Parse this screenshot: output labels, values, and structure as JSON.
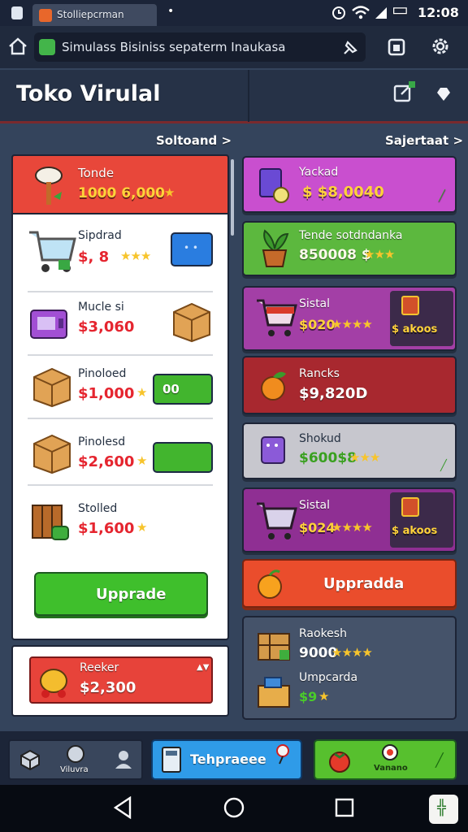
{
  "status_bar": {
    "time": "12:08",
    "tab_title": "Stolliepcrman",
    "tab_dot": "•",
    "battery": "▭"
  },
  "url_bar": {
    "url_text": "Simulass Bisiniss sepaterm Inaukasa",
    "pin_icon": "pin-icon"
  },
  "header": {
    "title": "Toko Virulal"
  },
  "section_links": {
    "left": "Soltoand >",
    "right": "Sajertaat >"
  },
  "left_panel": {
    "top": {
      "label": "Tonde",
      "price": "1000 6,000"
    },
    "items": [
      {
        "label": "Sipdrad",
        "price": "$, 8",
        "rating": 3
      },
      {
        "label": "Mucle si",
        "price": "$3,060"
      },
      {
        "label": "Pinoloed",
        "price": "$1,000",
        "button": "00"
      },
      {
        "label": "Pinolesd",
        "price": "$2,600"
      },
      {
        "label": "Stolled",
        "price": "$1,600"
      }
    ],
    "upgrade_button": "Upprade",
    "bottom": {
      "label": "Reeker",
      "price": "$2,300"
    }
  },
  "right_panel": {
    "cards": [
      {
        "label": "Yackad",
        "price": "$ $8,0040",
        "color": "#c94fcf"
      },
      {
        "label": "Tende sotdndanka",
        "price": "850008 $",
        "rating": 3,
        "color": "#5cb83e"
      },
      {
        "label": "Sistal",
        "price": "$020",
        "rating": 4,
        "badge": "$ akoos",
        "color": "#a33fa6"
      },
      {
        "label": "Rancks",
        "price": "$9,820D",
        "color": "#a8282f"
      },
      {
        "label": "Shokud",
        "price": "$600$8",
        "rating": 3,
        "color": "#c7c7ce"
      },
      {
        "label": "Sistal",
        "price": "$024",
        "rating": 4,
        "badge": "$ akoos",
        "color": "#8f2f93"
      }
    ],
    "upgrade_button": "Uppradda",
    "bottom": {
      "item1": {
        "label": "Raokesh",
        "price": "9000",
        "rating": 4
      },
      "item2": {
        "label": "Umpcarda",
        "price": "$9"
      }
    }
  },
  "bottom_bar": {
    "bag_label": "Viluvra",
    "blue_button": "Tehpraeee",
    "green_button": "Vanano"
  },
  "colors": {
    "accent_red": "#ea4d2c",
    "accent_green": "#57c02e",
    "gold": "#ffd23a",
    "panel": "#34445c"
  }
}
